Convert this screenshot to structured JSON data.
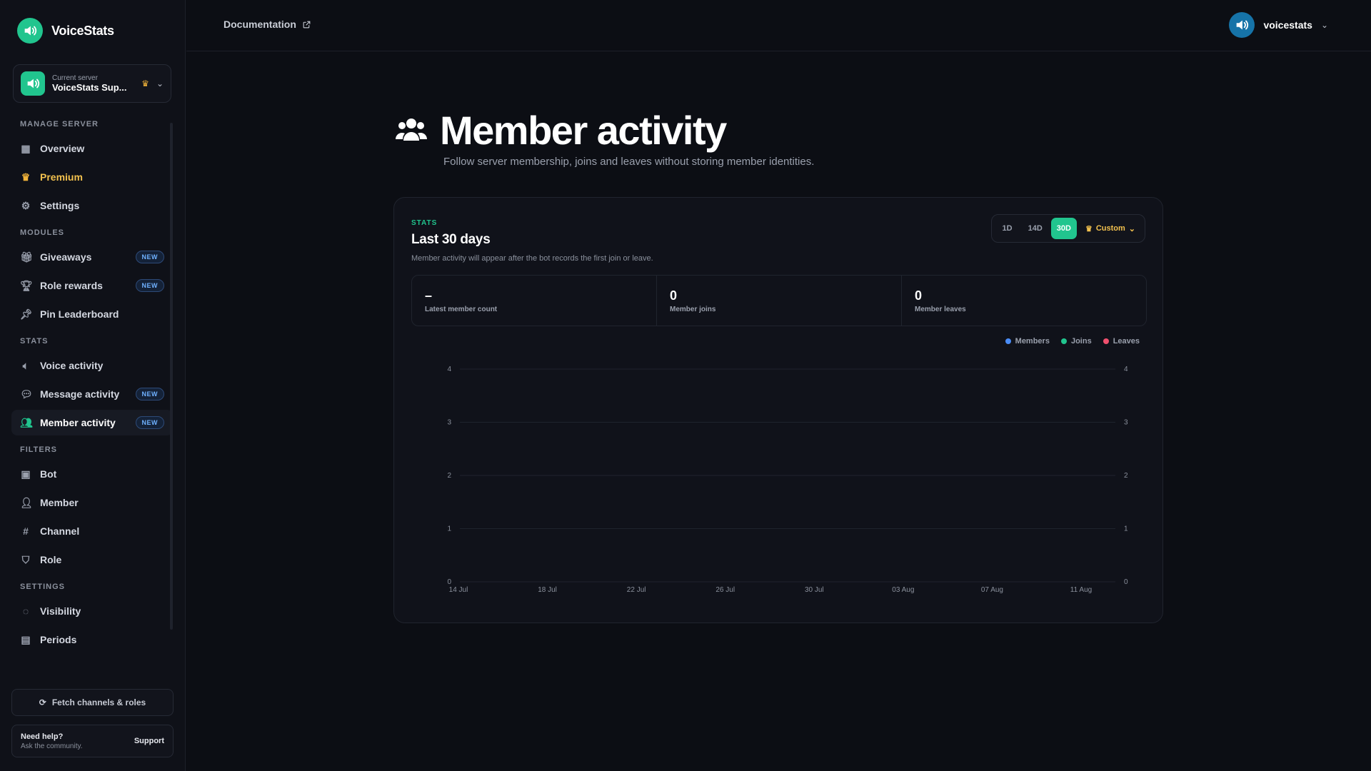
{
  "brand": {
    "name": "VoiceStats"
  },
  "server": {
    "caption": "Current server",
    "name": "VoiceStats Sup..."
  },
  "nav": {
    "sections": [
      {
        "title": "MANAGE SERVER",
        "items": [
          {
            "label": "Overview",
            "icon": "grid-icon"
          },
          {
            "label": "Premium",
            "icon": "crown-icon"
          },
          {
            "label": "Settings",
            "icon": "gear-icon"
          }
        ]
      },
      {
        "title": "MODULES",
        "items": [
          {
            "label": "Giveaways",
            "icon": "gift-icon",
            "badge": "NEW"
          },
          {
            "label": "Role rewards",
            "icon": "trophy-icon",
            "badge": "NEW"
          },
          {
            "label": "Pin Leaderboard",
            "icon": "pin-icon"
          }
        ]
      },
      {
        "title": "STATS",
        "items": [
          {
            "label": "Voice activity",
            "icon": "speaker-icon"
          },
          {
            "label": "Message activity",
            "icon": "message-icon",
            "badge": "NEW"
          },
          {
            "label": "Member activity",
            "icon": "users-icon",
            "badge": "NEW",
            "active": true
          }
        ]
      },
      {
        "title": "FILTERS",
        "items": [
          {
            "label": "Bot",
            "icon": "bot-icon"
          },
          {
            "label": "Member",
            "icon": "user-icon"
          },
          {
            "label": "Channel",
            "icon": "hash-icon"
          },
          {
            "label": "Role",
            "icon": "shield-icon"
          }
        ]
      },
      {
        "title": "SETTINGS",
        "items": [
          {
            "label": "Visibility",
            "icon": "eye-off-icon"
          },
          {
            "label": "Periods",
            "icon": "calendar-icon"
          }
        ]
      }
    ]
  },
  "footer": {
    "fetch_label": "Fetch channels & roles",
    "help_title": "Need help?",
    "help_sub": "Ask the community.",
    "support_label": "Support"
  },
  "topbar": {
    "doc_label": "Documentation",
    "username": "voicestats"
  },
  "page": {
    "title": "Member activity",
    "subtitle": "Follow server membership, joins and leaves without storing member identities."
  },
  "card": {
    "eyebrow": "STATS",
    "title": "Last 30 days",
    "description": "Member activity will appear after the bot records the first join or leave.",
    "periods": [
      "1D",
      "14D",
      "30D"
    ],
    "active_period": "30D",
    "custom_label": "Custom",
    "kpis": [
      {
        "value": "–",
        "label": "Latest member count"
      },
      {
        "value": "0",
        "label": "Member joins"
      },
      {
        "value": "0",
        "label": "Member leaves"
      }
    ]
  },
  "colors": {
    "accent": "#21c58e",
    "members": "#4a8cf7",
    "joins": "#21c58e",
    "leaves": "#f0506e",
    "premium": "#f2c14e"
  },
  "chart_data": {
    "type": "line",
    "x": [
      "14 Jul",
      "18 Jul",
      "22 Jul",
      "26 Jul",
      "30 Jul",
      "03 Aug",
      "07 Aug",
      "11 Aug"
    ],
    "series": [
      {
        "name": "Members",
        "values": []
      },
      {
        "name": "Joins",
        "values": []
      },
      {
        "name": "Leaves",
        "values": []
      }
    ],
    "yticks_left": [
      0,
      1,
      2,
      3,
      4
    ],
    "yticks_right": [
      0,
      1,
      2,
      3,
      4
    ],
    "ylim": [
      0,
      4
    ],
    "grid": true,
    "legend": "top-right"
  }
}
